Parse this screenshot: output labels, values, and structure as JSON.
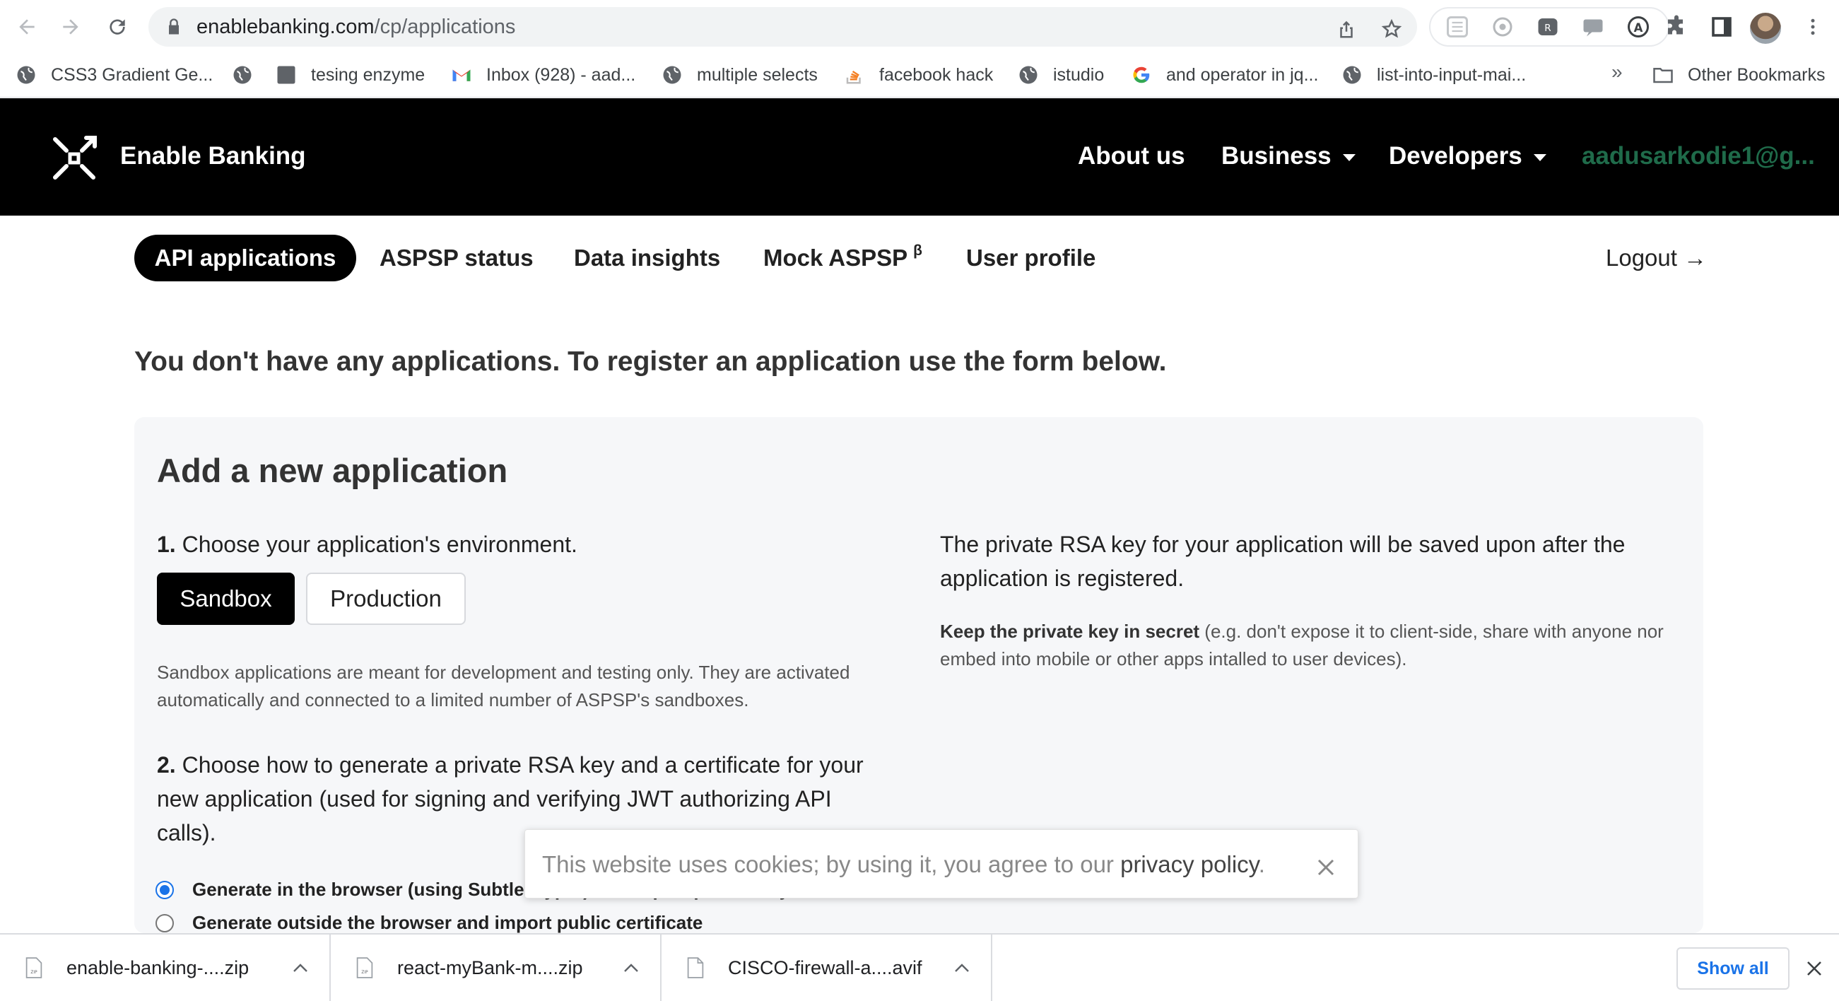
{
  "browser": {
    "url_host": "enablebanking.com",
    "url_path": "/cp/applications",
    "icons": {
      "back": "back-arrow-icon",
      "forward": "forward-arrow-icon",
      "reload": "reload-icon",
      "lock": "lock-icon",
      "share": "share-icon",
      "bookmark_star": "star-icon",
      "extensions": "puzzle-icon",
      "sidebar": "side-panel-icon",
      "menu": "kebab-menu-icon"
    },
    "bookmarks": [
      {
        "label": "CSS3 Gradient Ge...",
        "icon": "globe-icon"
      },
      {
        "label": "",
        "icon": "globe-icon"
      },
      {
        "label": "tesing enzyme",
        "icon": "square-icon"
      },
      {
        "label": "Inbox (928) - aad...",
        "icon": "gmail-icon"
      },
      {
        "label": "multiple selects",
        "icon": "globe-icon"
      },
      {
        "label": "facebook hack",
        "icon": "stackoverflow-icon"
      },
      {
        "label": "istudio",
        "icon": "globe-icon"
      },
      {
        "label": "and operator in jq...",
        "icon": "google-icon"
      },
      {
        "label": "list-into-input-mai...",
        "icon": "globe-icon"
      }
    ],
    "bookmarks_overflow": "»",
    "other_bookmarks": "Other Bookmarks"
  },
  "site": {
    "brand": "Enable Banking",
    "nav": {
      "about": "About us",
      "business": "Business",
      "developers": "Developers",
      "user": "aadusarkodie1@g..."
    },
    "tabs": {
      "api_applications": "API applications",
      "aspsp_status": "ASPSP status",
      "data_insights": "Data insights",
      "mock_aspsp": "Mock ASPSP",
      "mock_aspsp_sup": "β",
      "user_profile": "User profile",
      "logout": "Logout →"
    }
  },
  "main": {
    "intro": "You don't have any applications. To register an application use the form below.",
    "form_title": "Add a new application",
    "step1_num": "1.",
    "step1_text": "Choose your application's environment.",
    "env_sandbox": "Sandbox",
    "env_production": "Production",
    "env_selected": "Sandbox",
    "env_help": "Sandbox applications are meant for development and testing only. They are activated automatically and connected to a limited number of ASPSP's sandboxes.",
    "step2_num": "2.",
    "step2_text": "Choose how to generate a private RSA key and a certificate for your new application (used for signing and verifying JWT authorizing API calls).",
    "radio_browser": "Generate in the browser (using SubtleCrypto) and export private key",
    "radio_outside": "Generate outside the browser and import public certificate",
    "radio_selected": "browser",
    "right_text": "The private RSA key for your application will be saved upon after the application is registered.",
    "right_note_bold": "Keep the private key in secret",
    "right_note_rest": " (e.g. don't expose it to client-side, share with anyone nor embed into mobile or other apps intalled to user devices)."
  },
  "cookie": {
    "text": "This website uses cookies; by using it, you agree to our ",
    "link": "privacy policy",
    "end": "."
  },
  "downloads": {
    "items": [
      {
        "name": "enable-banking-....zip",
        "type": "zip"
      },
      {
        "name": "react-myBank-m....zip",
        "type": "zip"
      },
      {
        "name": "CISCO-firewall-a....avif",
        "type": "file"
      }
    ],
    "show_all": "Show all"
  },
  "colors": {
    "header_bg": "#000000",
    "panel_bg": "#f6f7f9",
    "accent_blue": "#1a73e8",
    "user_email": "#1f6b4a"
  }
}
